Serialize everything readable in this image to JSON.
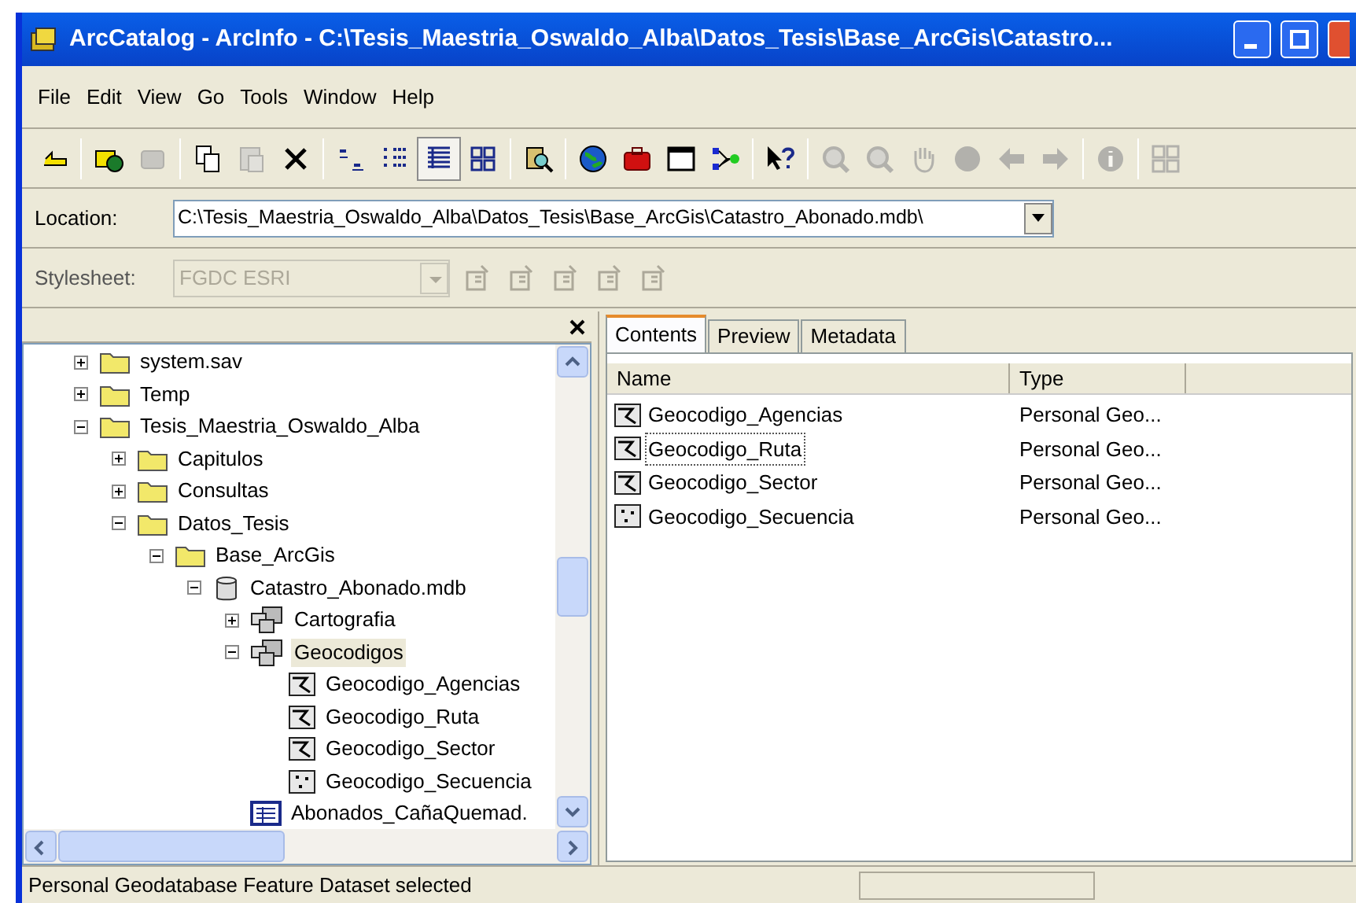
{
  "window": {
    "title": "ArcCatalog - ArcInfo - C:\\Tesis_Maestria_Oswaldo_Alba\\Datos_Tesis\\Base_ArcGis\\Catastro..."
  },
  "menu": [
    "File",
    "Edit",
    "View",
    "Go",
    "Tools",
    "Window",
    "Help"
  ],
  "toolbar": [
    {
      "kind": "up",
      "disabled": false,
      "selected": false
    },
    {
      "kind": "sep"
    },
    {
      "kind": "connect",
      "disabled": false,
      "selected": false
    },
    {
      "kind": "disconnect",
      "disabled": true,
      "selected": false
    },
    {
      "kind": "sep"
    },
    {
      "kind": "copy",
      "disabled": false,
      "selected": false
    },
    {
      "kind": "paste",
      "disabled": true,
      "selected": false
    },
    {
      "kind": "delete",
      "disabled": false,
      "selected": false
    },
    {
      "kind": "sep"
    },
    {
      "kind": "largeicons",
      "disabled": false,
      "selected": false
    },
    {
      "kind": "list",
      "disabled": false,
      "selected": false
    },
    {
      "kind": "details",
      "disabled": false,
      "selected": true
    },
    {
      "kind": "thumbnails",
      "disabled": false,
      "selected": false
    },
    {
      "kind": "sep"
    },
    {
      "kind": "search",
      "disabled": false,
      "selected": false
    },
    {
      "kind": "sep"
    },
    {
      "kind": "globe",
      "disabled": false,
      "selected": false
    },
    {
      "kind": "toolbox",
      "disabled": false,
      "selected": false
    },
    {
      "kind": "window",
      "disabled": false,
      "selected": false
    },
    {
      "kind": "model",
      "disabled": false,
      "selected": false
    },
    {
      "kind": "sep"
    },
    {
      "kind": "help",
      "disabled": false,
      "selected": false
    },
    {
      "kind": "sep"
    },
    {
      "kind": "zoomin",
      "disabled": true,
      "selected": false
    },
    {
      "kind": "zoomout",
      "disabled": true,
      "selected": false
    },
    {
      "kind": "pan",
      "disabled": true,
      "selected": false
    },
    {
      "kind": "full",
      "disabled": true,
      "selected": false
    },
    {
      "kind": "back",
      "disabled": true,
      "selected": false
    },
    {
      "kind": "forward",
      "disabled": true,
      "selected": false
    },
    {
      "kind": "sep"
    },
    {
      "kind": "identify",
      "disabled": true,
      "selected": false
    },
    {
      "kind": "sep"
    },
    {
      "kind": "layers",
      "disabled": true,
      "selected": false
    }
  ],
  "location": {
    "label": "Location:",
    "value": "C:\\Tesis_Maestria_Oswaldo_Alba\\Datos_Tesis\\Base_ArcGis\\Catastro_Abonado.mdb\\"
  },
  "stylesheet": {
    "label": "Stylesheet:",
    "value": "FGDC ESRI",
    "disabled": true
  },
  "tree": [
    {
      "label": "system.sav",
      "kind": "folder",
      "expanded": false,
      "selected": false
    },
    {
      "label": "Temp",
      "kind": "folder",
      "expanded": false,
      "selected": false
    },
    {
      "label": "Tesis_Maestria_Oswaldo_Alba",
      "kind": "folder",
      "expanded": true,
      "selected": false,
      "children": [
        {
          "label": "Capitulos",
          "kind": "folder",
          "expanded": false,
          "selected": false
        },
        {
          "label": "Consultas",
          "kind": "folder",
          "expanded": false,
          "selected": false
        },
        {
          "label": "Datos_Tesis",
          "kind": "folder",
          "expanded": true,
          "selected": false,
          "children": [
            {
              "label": "Base_ArcGis",
              "kind": "folder",
              "expanded": true,
              "selected": false,
              "children": [
                {
                  "label": "Catastro_Abonado.mdb",
                  "kind": "database",
                  "expanded": true,
                  "selected": false,
                  "children": [
                    {
                      "label": "Cartografia",
                      "kind": "dataset",
                      "expanded": false,
                      "selected": false
                    },
                    {
                      "label": "Geocodigos",
                      "kind": "dataset",
                      "expanded": true,
                      "selected": true,
                      "children": [
                        {
                          "label": "Geocodigo_Agencias",
                          "kind": "lines",
                          "selected": false
                        },
                        {
                          "label": "Geocodigo_Ruta",
                          "kind": "lines",
                          "selected": false
                        },
                        {
                          "label": "Geocodigo_Sector",
                          "kind": "lines",
                          "selected": false
                        },
                        {
                          "label": "Geocodigo_Secuencia",
                          "kind": "points",
                          "selected": false
                        }
                      ]
                    },
                    {
                      "label": "Abonados_CañaQuemad.",
                      "kind": "table",
                      "selected": false
                    }
                  ]
                }
              ]
            }
          ]
        }
      ]
    }
  ],
  "tabs": [
    {
      "label": "Contents",
      "selected": true
    },
    {
      "label": "Preview",
      "selected": false
    },
    {
      "label": "Metadata",
      "selected": false
    }
  ],
  "contents": {
    "columns": [
      "Name",
      "Type"
    ],
    "rows": [
      {
        "name": "Geocodigo_Agencias",
        "kind": "lines",
        "type": "Personal Geo...",
        "focused": false
      },
      {
        "name": "Geocodigo_Ruta",
        "kind": "lines",
        "type": "Personal Geo...",
        "focused": true
      },
      {
        "name": "Geocodigo_Sector",
        "kind": "lines",
        "type": "Personal Geo...",
        "focused": false
      },
      {
        "name": "Geocodigo_Secuencia",
        "kind": "points",
        "type": "Personal Geo...",
        "focused": false
      }
    ]
  },
  "status_bar": "Personal Geodatabase Feature Dataset selected"
}
